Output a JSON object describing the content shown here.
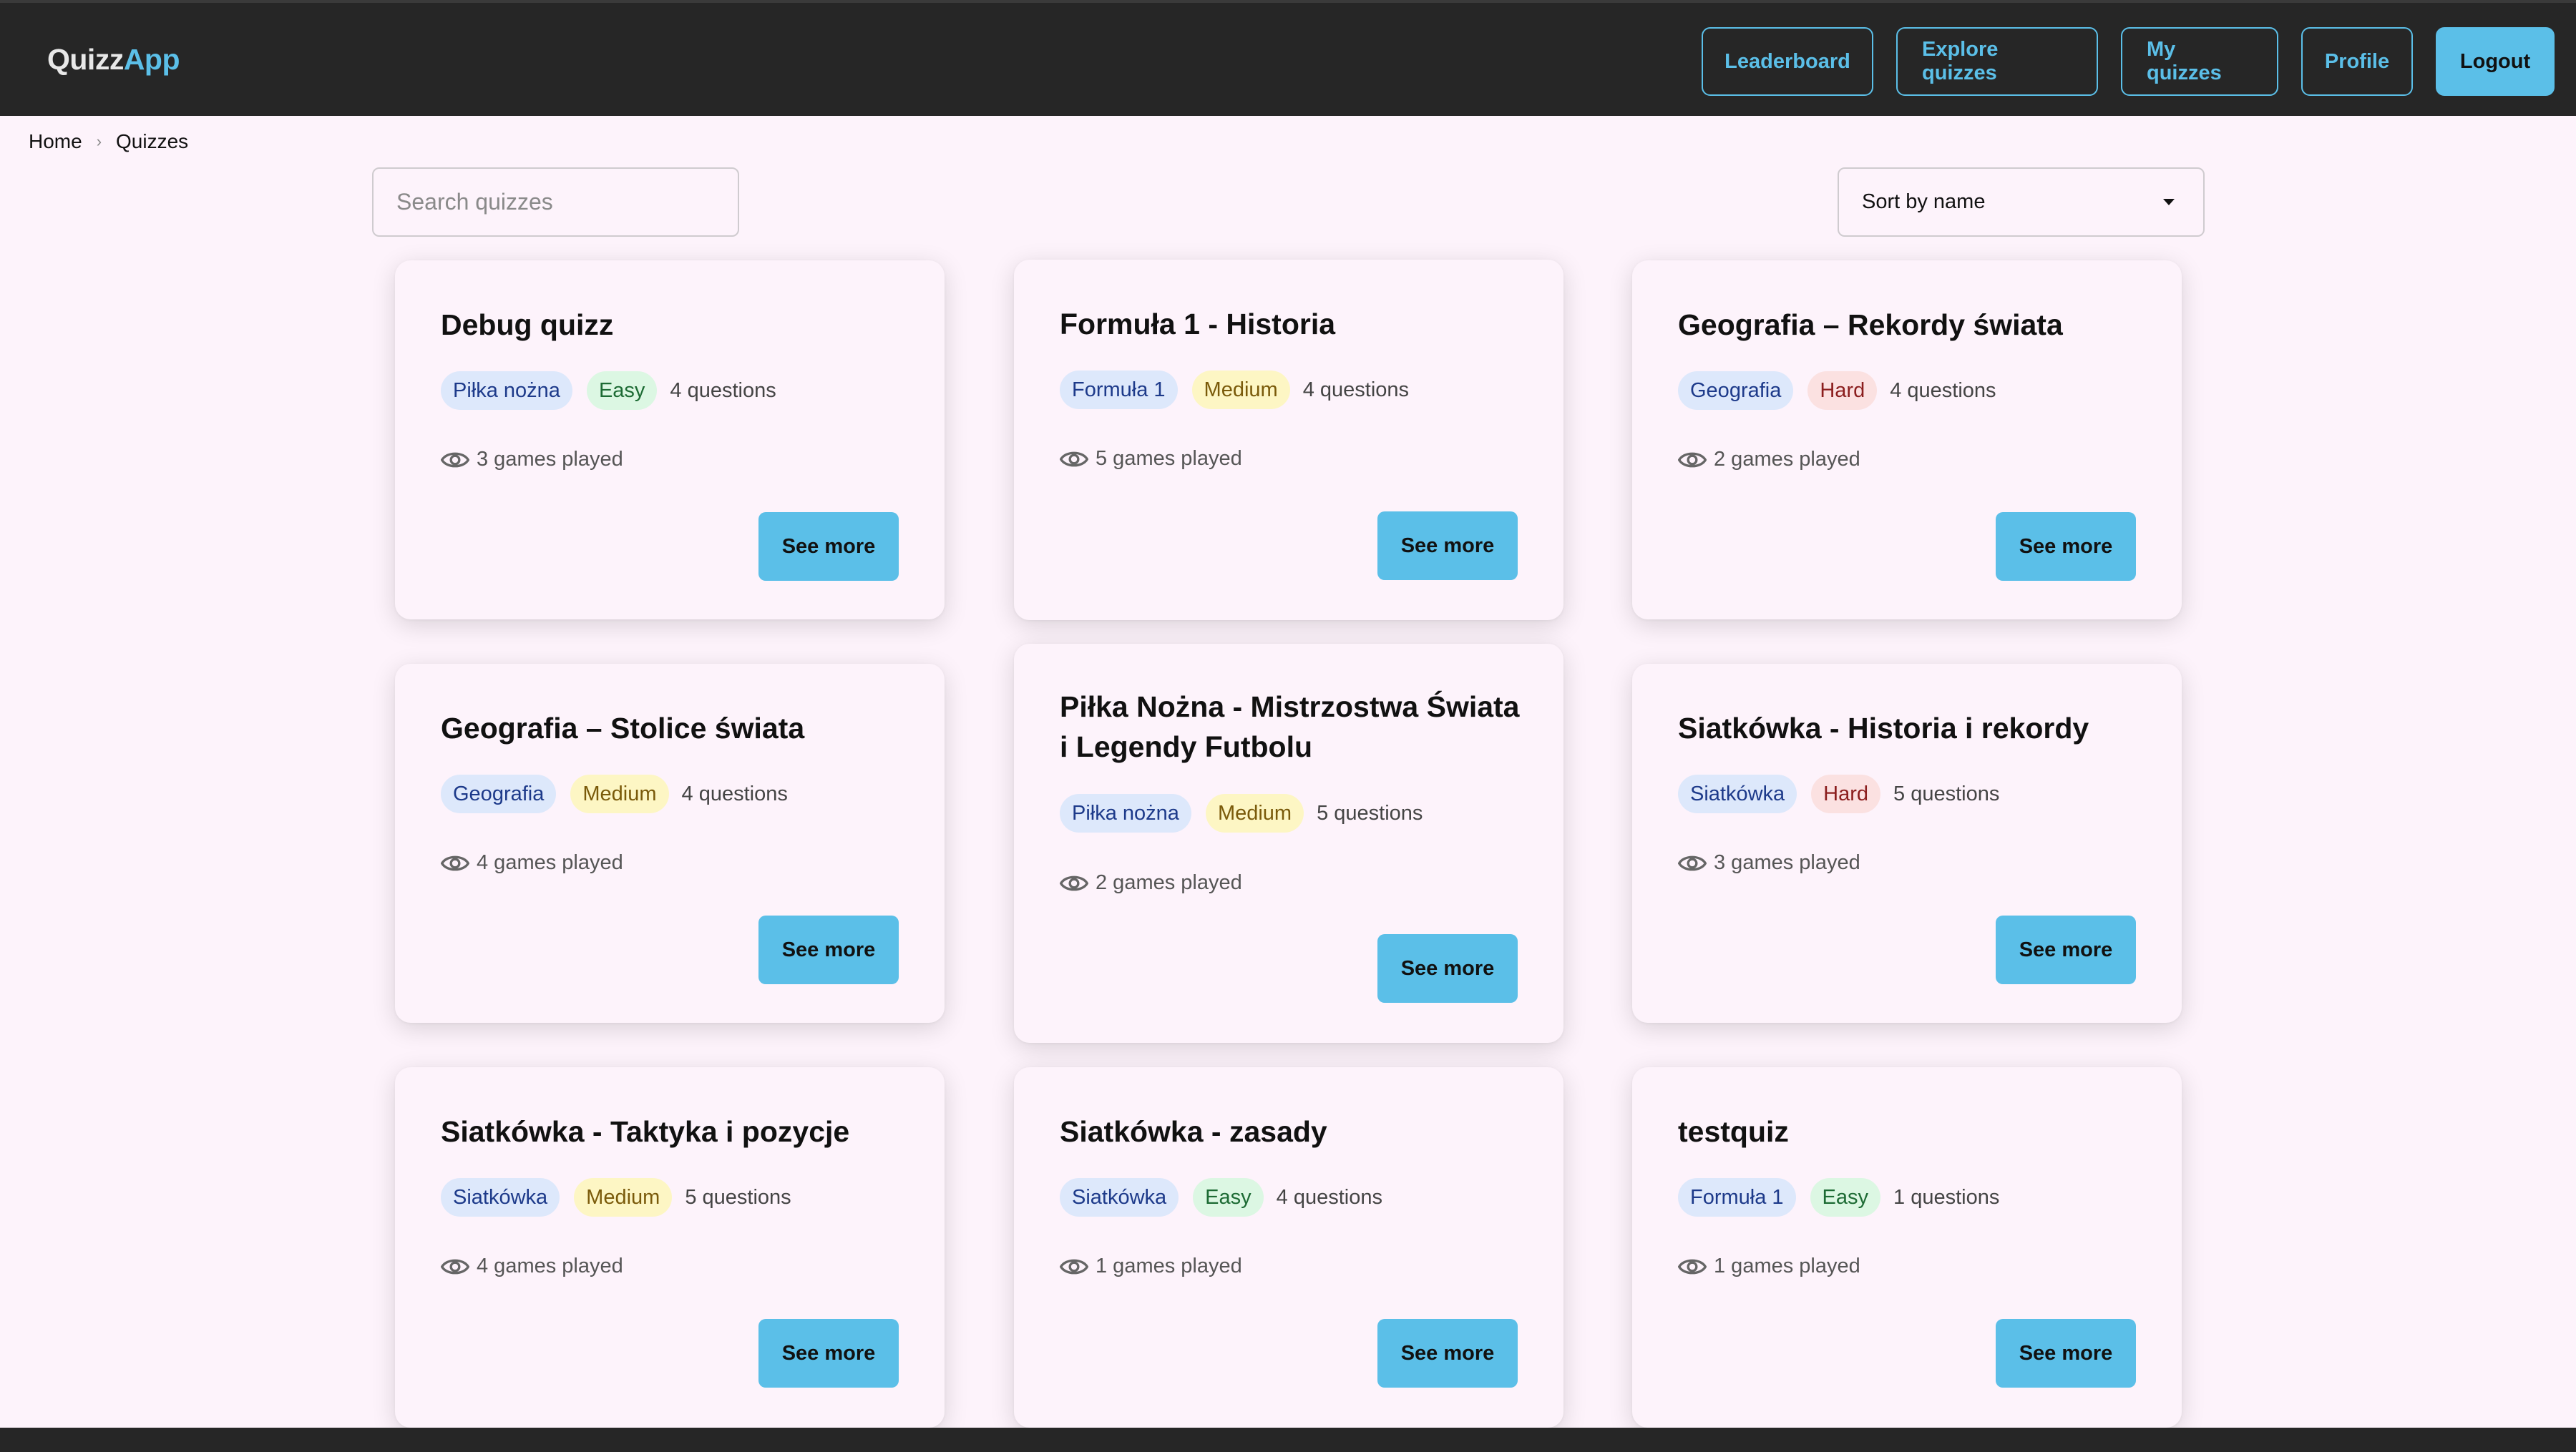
{
  "header": {
    "logo_part1": "Quizz",
    "logo_part2": "App",
    "nav": {
      "leaderboard": "Leaderboard",
      "explore": "Explore quizzes",
      "my_quizzes": "My quizzes",
      "profile": "Profile",
      "logout": "Logout"
    }
  },
  "breadcrumb": {
    "home": "Home",
    "current": "Quizzes"
  },
  "search": {
    "placeholder": "Search quizzes"
  },
  "sort": {
    "selected": "Sort by name"
  },
  "see_more_label": "See more",
  "colors": {
    "accent": "#5bbfe8",
    "header_bg": "#262626",
    "page_bg": "#fdf3fb"
  },
  "quizzes": [
    {
      "title": "Debug quizz",
      "category": "Piłka nożna",
      "difficulty": "Easy",
      "questions": "4 questions",
      "played": "3 games played"
    },
    {
      "title": "Formuła 1 - Historia",
      "category": "Formuła 1",
      "difficulty": "Medium",
      "questions": "4 questions",
      "played": "5 games played"
    },
    {
      "title": "Geografia – Rekordy świata",
      "category": "Geografia",
      "difficulty": "Hard",
      "questions": "4 questions",
      "played": "2 games played"
    },
    {
      "title": "Geografia – Stolice świata",
      "category": "Geografia",
      "difficulty": "Medium",
      "questions": "4 questions",
      "played": "4 games played"
    },
    {
      "title": "Piłka Nożna - Mistrzostwa Świata i Legendy Futbolu",
      "category": "Piłka nożna",
      "difficulty": "Medium",
      "questions": "5 questions",
      "played": "2 games played"
    },
    {
      "title": "Siatkówka - Historia i rekordy",
      "category": "Siatkówka",
      "difficulty": "Hard",
      "questions": "5 questions",
      "played": "3 games played"
    },
    {
      "title": "Siatkówka - Taktyka i pozycje",
      "category": "Siatkówka",
      "difficulty": "Medium",
      "questions": "5 questions",
      "played": "4 games played"
    },
    {
      "title": "Siatkówka - zasady",
      "category": "Siatkówka",
      "difficulty": "Easy",
      "questions": "4 questions",
      "played": "1 games played"
    },
    {
      "title": "testquiz",
      "category": "Formuła 1",
      "difficulty": "Easy",
      "questions": "1 questions",
      "played": "1 games played"
    }
  ]
}
